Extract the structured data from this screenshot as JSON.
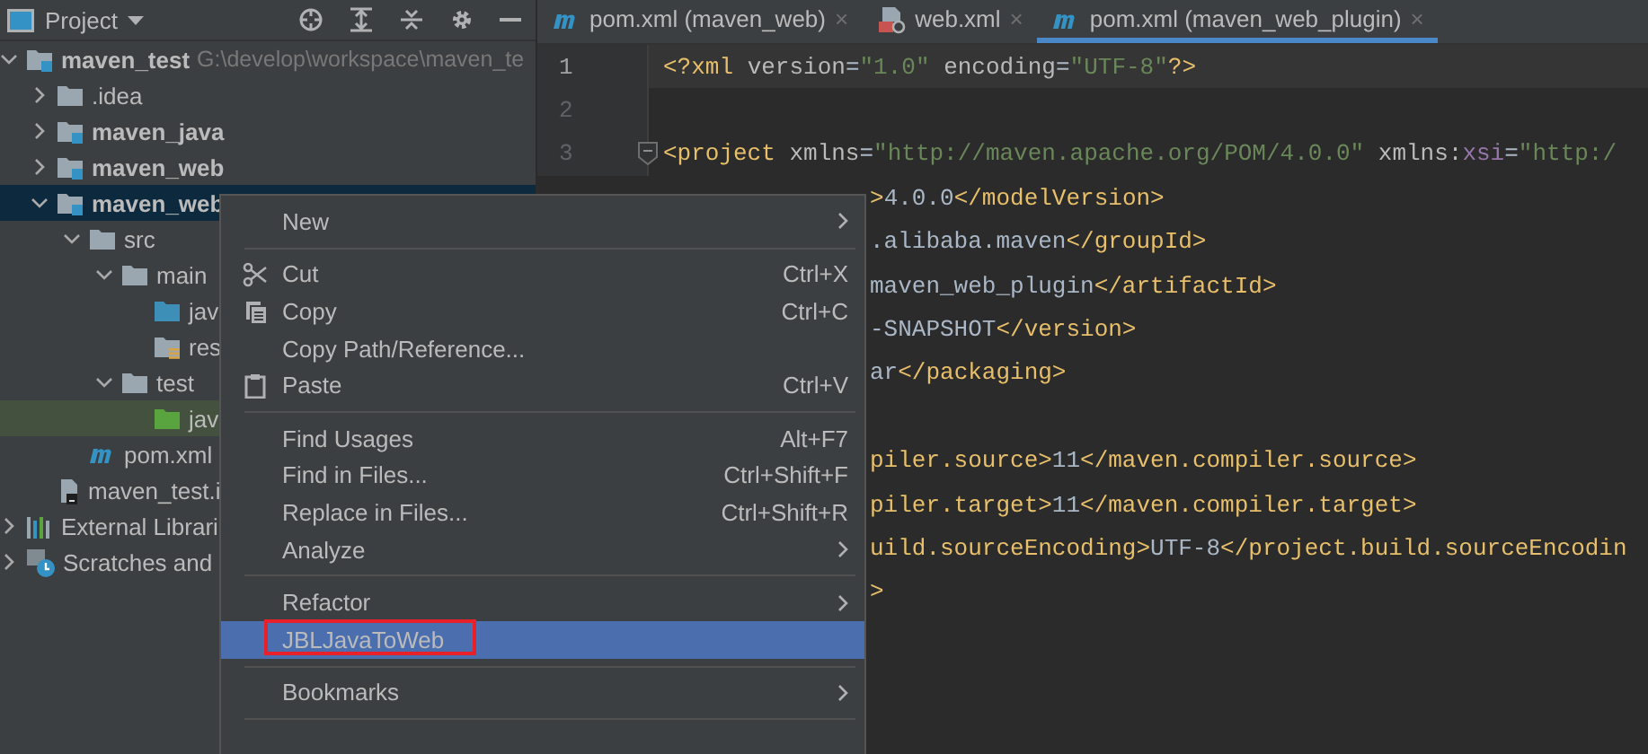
{
  "sidebar": {
    "title": "Project",
    "tree": [
      {
        "name": "maven_test",
        "path": "G:\\develop\\workspace\\maven_te",
        "kind": "module",
        "expanded": true,
        "selected": false,
        "highlighted": false,
        "children": [
          {
            "name": ".idea",
            "kind": "folder",
            "expanded": false,
            "selected": false,
            "highlighted": false
          },
          {
            "name": "maven_java",
            "kind": "module",
            "expanded": false,
            "selected": false,
            "highlighted": false
          },
          {
            "name": "maven_web",
            "kind": "module",
            "expanded": false,
            "selected": false,
            "highlighted": false
          },
          {
            "name": "maven_web",
            "kind": "module",
            "expanded": true,
            "selected": true,
            "highlighted": false,
            "children": [
              {
                "name": "src",
                "kind": "folder",
                "expanded": true,
                "selected": false,
                "highlighted": false,
                "children": [
                  {
                    "name": "main",
                    "kind": "folder",
                    "expanded": true,
                    "selected": false,
                    "highlighted": false,
                    "children": [
                      {
                        "name": "jav",
                        "kind": "source",
                        "selected": false,
                        "highlighted": false
                      },
                      {
                        "name": "res",
                        "kind": "resources",
                        "selected": false,
                        "highlighted": false
                      }
                    ]
                  },
                  {
                    "name": "test",
                    "kind": "folder",
                    "expanded": true,
                    "selected": false,
                    "highlighted": false,
                    "children": [
                      {
                        "name": "jav",
                        "kind": "test-source",
                        "selected": false,
                        "highlighted": true
                      }
                    ]
                  }
                ]
              },
              {
                "name": "pom.xml",
                "kind": "maven",
                "selected": false,
                "highlighted": false
              }
            ]
          },
          {
            "name": "maven_test.i",
            "kind": "iml",
            "selected": false,
            "highlighted": false
          }
        ]
      },
      {
        "name": "External Librari",
        "kind": "libraries",
        "expanded": false,
        "selected": false,
        "highlighted": false
      },
      {
        "name": "Scratches and",
        "kind": "scratches",
        "expanded": false,
        "selected": false,
        "highlighted": false
      }
    ]
  },
  "tabs": [
    {
      "label": "pom.xml (maven_web)",
      "kind": "maven",
      "close": "×",
      "selected": false
    },
    {
      "label": "web.xml",
      "kind": "web",
      "close": "×",
      "selected": false
    },
    {
      "label": "pom.xml (maven_web_plugin)",
      "kind": "maven",
      "close": "×",
      "selected": true
    }
  ],
  "editor": {
    "lines": [
      {
        "kind": "full",
        "number": "1",
        "current": true,
        "tokens": [
          {
            "t": "<?xml",
            "kind": "tag"
          },
          {
            "t": " version",
            "kind": "attr"
          },
          {
            "t": "=",
            "kind": "text"
          },
          {
            "t": "\"1.0\"",
            "kind": "value"
          },
          {
            "t": " encoding",
            "kind": "attr"
          },
          {
            "t": "=",
            "kind": "text"
          },
          {
            "t": "\"UTF-8\"",
            "kind": "value"
          },
          {
            "t": "?>",
            "kind": "tag"
          }
        ]
      },
      {
        "kind": "full",
        "number": "2",
        "current": false
      },
      {
        "kind": "full",
        "number": "3",
        "current": false,
        "fold": true,
        "tokens": [
          {
            "t": "<project",
            "kind": "tag"
          },
          {
            "t": " xmlns",
            "kind": "attr"
          },
          {
            "t": "=",
            "kind": "text"
          },
          {
            "t": "\"http://maven.apache.org/POM/4.0.0\"",
            "kind": "value"
          },
          {
            "t": " xmlns:",
            "kind": "attr"
          },
          {
            "t": "xsi",
            "kind": "ns"
          },
          {
            "t": "=",
            "kind": "text"
          },
          {
            "t": "\"http:/",
            "kind": "value"
          }
        ]
      },
      {
        "kind": "partial",
        "tokens": [
          {
            "t": ">",
            "kind": "tag"
          },
          {
            "t": "4.0.0",
            "kind": "text"
          },
          {
            "t": "</modelVersion>",
            "kind": "tag"
          }
        ]
      },
      {
        "kind": "partial",
        "tokens": [
          {
            "t": ".alibaba.maven",
            "kind": "text"
          },
          {
            "t": "</groupId>",
            "kind": "tag"
          }
        ]
      },
      {
        "kind": "partial",
        "tokens": [
          {
            "t": "maven_web_plugin",
            "kind": "text"
          },
          {
            "t": "</artifactId>",
            "kind": "tag"
          }
        ]
      },
      {
        "kind": "partial",
        "tokens": [
          {
            "t": "-SNAPSHOT",
            "kind": "text"
          },
          {
            "t": "</version>",
            "kind": "tag"
          }
        ]
      },
      {
        "kind": "partial",
        "tokens": [
          {
            "t": "ar",
            "kind": "text"
          },
          {
            "t": "</packaging>",
            "kind": "tag"
          }
        ]
      },
      {
        "kind": "partial"
      },
      {
        "kind": "partial",
        "tokens": [
          {
            "t": "piler.source>",
            "kind": "tag"
          },
          {
            "t": "11",
            "kind": "text"
          },
          {
            "t": "</maven.compiler.source>",
            "kind": "tag"
          }
        ]
      },
      {
        "kind": "partial",
        "tokens": [
          {
            "t": "piler.target>",
            "kind": "tag"
          },
          {
            "t": "11",
            "kind": "text"
          },
          {
            "t": "</maven.compiler.target>",
            "kind": "tag"
          }
        ]
      },
      {
        "kind": "partial",
        "tokens": [
          {
            "t": "uild.sourceEncoding>",
            "kind": "tag"
          },
          {
            "t": "UTF-8",
            "kind": "text"
          },
          {
            "t": "</project.build.sourceEncodin",
            "kind": "tag"
          }
        ]
      },
      {
        "kind": "partial",
        "tokens": [
          {
            "t": ">",
            "kind": "tag"
          }
        ]
      }
    ]
  },
  "context_menu": [
    {
      "kind": "item",
      "label": "New",
      "submenu": true,
      "selected": false,
      "outlined": false
    },
    {
      "kind": "separator"
    },
    {
      "kind": "item",
      "label": "Cut",
      "shortcut": "Ctrl+X",
      "selected": false,
      "outlined": false
    },
    {
      "kind": "item",
      "label": "Copy",
      "shortcut": "Ctrl+C",
      "selected": false,
      "outlined": false
    },
    {
      "kind": "item",
      "label": "Copy Path/Reference...",
      "selected": false,
      "outlined": false
    },
    {
      "kind": "item",
      "label": "Paste",
      "shortcut": "Ctrl+V",
      "selected": false,
      "outlined": false
    },
    {
      "kind": "separator"
    },
    {
      "kind": "item",
      "label": "Find Usages",
      "shortcut": "Alt+F7",
      "selected": false,
      "outlined": false
    },
    {
      "kind": "item",
      "label": "Find in Files...",
      "shortcut": "Ctrl+Shift+F",
      "selected": false,
      "outlined": false
    },
    {
      "kind": "item",
      "label": "Replace in Files...",
      "shortcut": "Ctrl+Shift+R",
      "selected": false,
      "outlined": false
    },
    {
      "kind": "item",
      "label": "Analyze",
      "submenu": true,
      "selected": false,
      "outlined": false
    },
    {
      "kind": "separator"
    },
    {
      "kind": "item",
      "label": "Refactor",
      "submenu": true,
      "selected": false,
      "outlined": false
    },
    {
      "kind": "item",
      "label": "JBLJavaToWeb",
      "selected": true,
      "outlined": true
    },
    {
      "kind": "separator"
    },
    {
      "kind": "item",
      "label": "Bookmarks",
      "submenu": true,
      "selected": false,
      "outlined": false
    },
    {
      "kind": "separator"
    }
  ]
}
